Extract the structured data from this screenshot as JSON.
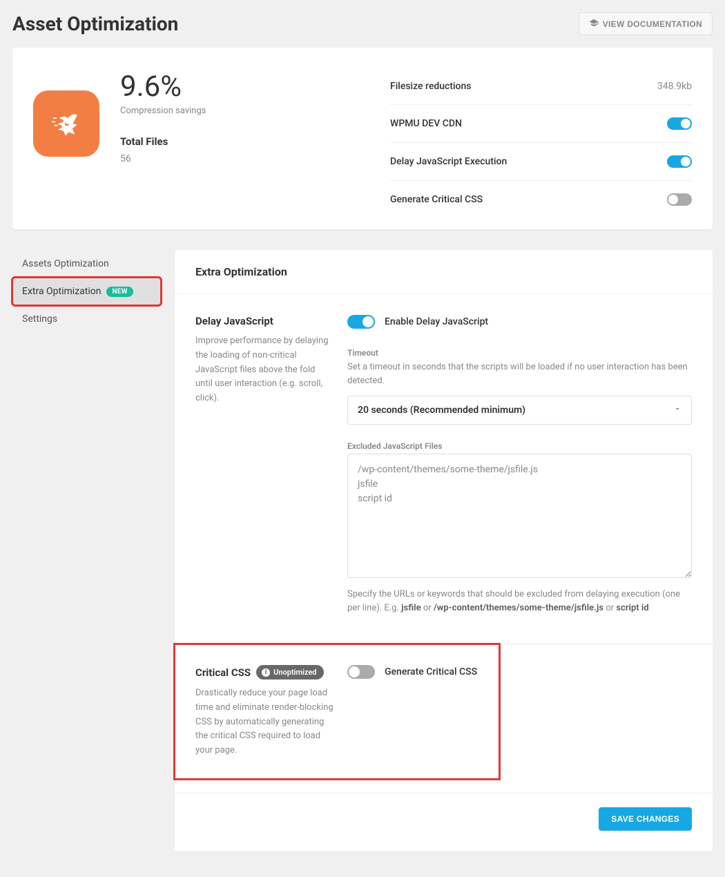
{
  "page": {
    "title": "Asset Optimization",
    "doc_button": "VIEW DOCUMENTATION"
  },
  "summary": {
    "percent": "9.6%",
    "percent_label": "Compression savings",
    "total_files_label": "Total Files",
    "total_files_value": "56",
    "rows": [
      {
        "label": "Filesize reductions",
        "value": "348.9kb",
        "type": "text"
      },
      {
        "label": "WPMU DEV CDN",
        "toggle": true,
        "type": "toggle"
      },
      {
        "label": "Delay JavaScript Execution",
        "toggle": true,
        "type": "toggle"
      },
      {
        "label": "Generate Critical CSS",
        "toggle": false,
        "type": "toggle"
      }
    ]
  },
  "sidebar": {
    "items": [
      {
        "label": "Assets Optimization",
        "badge": null,
        "active": false
      },
      {
        "label": "Extra Optimization",
        "badge": "NEW",
        "active": true
      },
      {
        "label": "Settings",
        "badge": null,
        "active": false
      }
    ]
  },
  "main": {
    "title": "Extra Optimization",
    "delay_js": {
      "title": "Delay JavaScript",
      "desc": "Improve performance by delaying the loading of non-critical JavaScript files above the fold until user interaction (e.g. scroll, click).",
      "toggle_label": "Enable Delay JavaScript",
      "toggle": true,
      "timeout_label": "Timeout",
      "timeout_help": "Set a timeout in seconds that the scripts will be loaded if no user interaction has been detected.",
      "timeout_value": "20 seconds (Recommended minimum)",
      "excluded_label": "Excluded JavaScript Files",
      "excluded_value": "/wp-content/themes/some-theme/jsfile.js\njsfile\nscript id",
      "excluded_help_pre": "Specify the URLs or keywords that should be excluded from delaying execution (one per line). E.g. ",
      "excluded_help_ex1": "jsfile",
      "excluded_help_mid1": " or ",
      "excluded_help_ex2": "/wp-content/themes/some-theme/jsfile.js",
      "excluded_help_mid2": " or ",
      "excluded_help_ex3": "script id"
    },
    "critical_css": {
      "title": "Critical CSS",
      "badge": "Unoptimized",
      "desc": "Drastically reduce your page load time and eliminate render-blocking CSS by automatically generating the critical CSS required to load your page.",
      "toggle_label": "Generate Critical CSS",
      "toggle": false
    },
    "save_button": "SAVE CHANGES"
  }
}
